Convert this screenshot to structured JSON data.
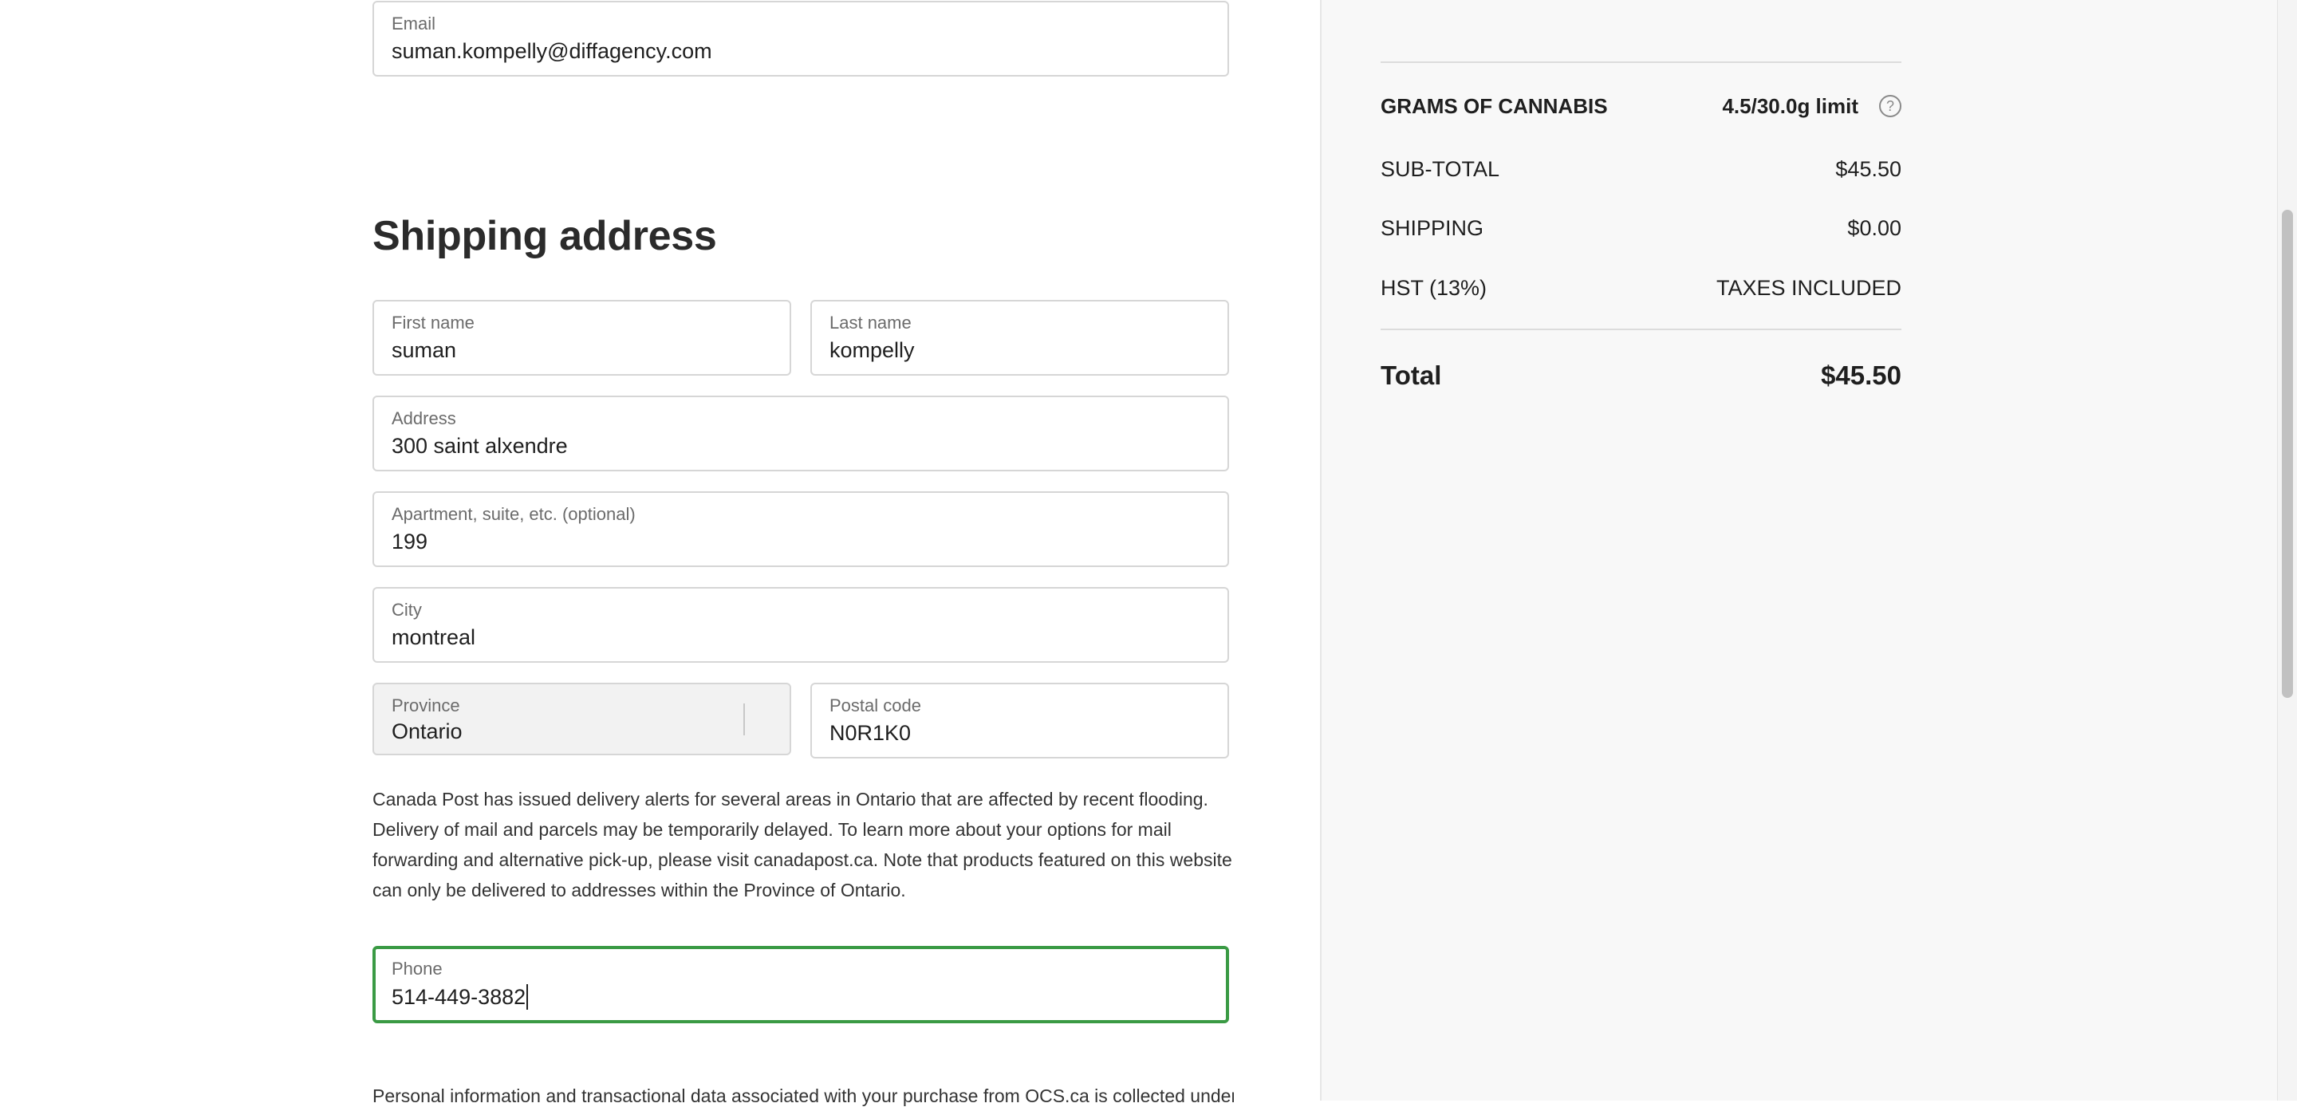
{
  "contact": {
    "email_label": "Email",
    "email_value": "suman.kompelly@diffagency.com"
  },
  "shipping": {
    "title": "Shipping address",
    "first_name": {
      "label": "First name",
      "value": "suman"
    },
    "last_name": {
      "label": "Last name",
      "value": "kompelly"
    },
    "address": {
      "label": "Address",
      "value": "300 saint alxendre"
    },
    "apartment": {
      "label": "Apartment, suite, etc. (optional)",
      "value": "199"
    },
    "city": {
      "label": "City",
      "value": "montreal"
    },
    "province": {
      "label": "Province",
      "value": "Ontario"
    },
    "postal_code": {
      "label": "Postal code",
      "value": "N0R1K0"
    },
    "notice": "Canada Post has issued delivery alerts for several areas in Ontario that are affected by recent flooding. Delivery of mail and parcels may be temporarily delayed. To learn more about your options for mail forwarding and alternative pick-up, please visit canadapost.ca. Note that products featured on this website can only be delivered to addresses within the Province of Ontario.",
    "phone": {
      "label": "Phone",
      "value": "514-449-3882"
    },
    "privacy_text": "Personal information and transactional data associated with your purchase from OCS.ca is collected under"
  },
  "summary": {
    "grams_label": "GRAMS OF CANNABIS",
    "grams_value": "4.5/30.0g limit",
    "help_icon_glyph": "?",
    "subtotal_label": "SUB-TOTAL",
    "subtotal_value": "$45.50",
    "shipping_label": "SHIPPING",
    "shipping_value": "$0.00",
    "tax_label": "HST (13%)",
    "tax_value": "TAXES INCLUDED",
    "total_label": "Total",
    "total_value": "$45.50"
  },
  "colors": {
    "focus_border": "#3a9a44",
    "panel_background": "#f8f8f8",
    "field_border": "#d6d6d6"
  }
}
